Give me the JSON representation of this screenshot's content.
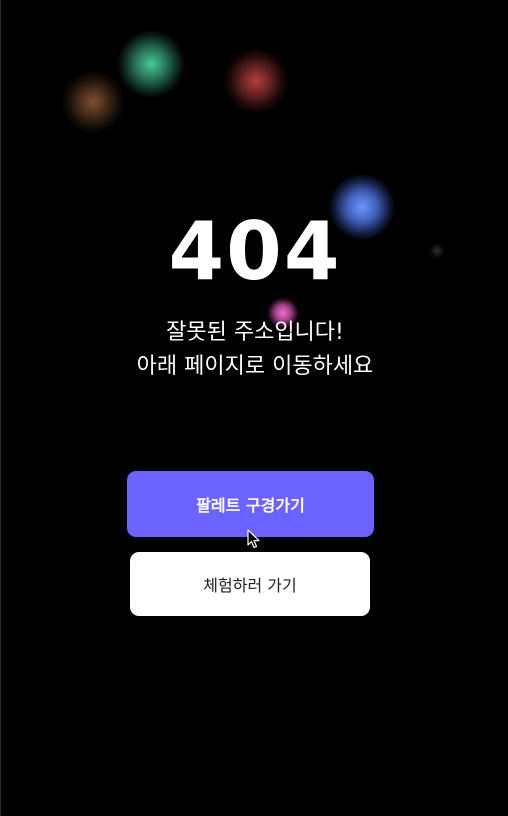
{
  "error": {
    "code": "404",
    "message_line1": "잘못된 주소입니다!",
    "message_line2": "아래 페이지로 이동하세요"
  },
  "actions": {
    "primary_label": "팔레트 구경가기",
    "secondary_label": "체험하러 가기"
  },
  "colors": {
    "background": "#000000",
    "primary_button": "#6c63ff",
    "secondary_button": "#ffffff",
    "text": "#ffffff"
  },
  "decor": {
    "orbs": [
      "green",
      "brown",
      "red",
      "blue",
      "pink",
      "dark"
    ],
    "cursor_icon": "mouse-pointer-icon"
  }
}
